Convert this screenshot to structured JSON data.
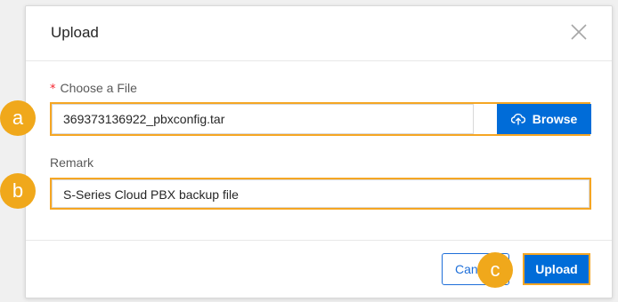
{
  "dialog": {
    "title": "Upload",
    "close_icon": "close-icon"
  },
  "file": {
    "required_mark": "*",
    "label": "Choose a File",
    "value": "369373136922_pbxconfig.tar",
    "browse_label": "Browse",
    "browse_icon": "cloud-upload-icon"
  },
  "remark": {
    "label": "Remark",
    "value": "S-Series Cloud PBX backup file"
  },
  "footer": {
    "cancel_label": "Cancel",
    "upload_label": "Upload"
  },
  "annotations": {
    "a": "a",
    "b": "b",
    "c": "c"
  },
  "colors": {
    "primary": "#006cd8",
    "highlight": "#f5a623",
    "badge": "#f0a81b",
    "required": "#f5222d"
  }
}
